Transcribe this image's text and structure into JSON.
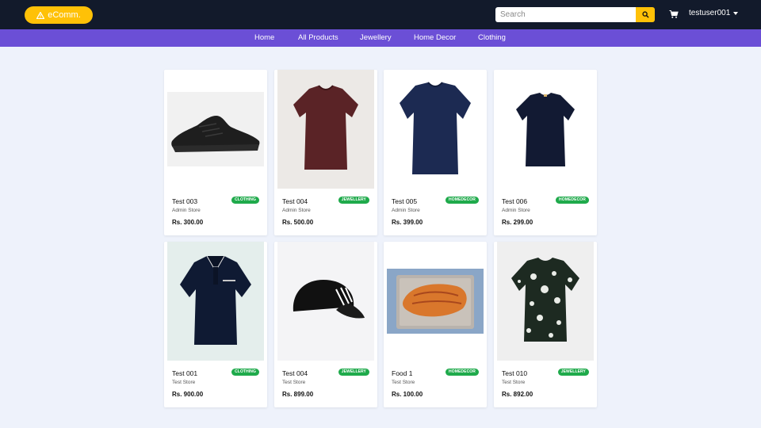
{
  "brand": {
    "name": "eComm.",
    "color": "#ffc107"
  },
  "search": {
    "placeholder": "Search"
  },
  "cart": {
    "icon": "cart-icon"
  },
  "user": {
    "name": "testuser001"
  },
  "nav": [
    {
      "label": "Home"
    },
    {
      "label": "All Products"
    },
    {
      "label": "Jewellery"
    },
    {
      "label": "Home Decor"
    },
    {
      "label": "Clothing"
    }
  ],
  "products": [
    {
      "title": "Test 003",
      "tag": "CLOTHING",
      "store": "Admin Store",
      "price": "Rs. 300.00",
      "image": "black-sneaker"
    },
    {
      "title": "Test 004",
      "tag": "JEWELLERY",
      "store": "Admin Store",
      "price": "Rs. 500.00",
      "image": "maroon-tshirt"
    },
    {
      "title": "Test 005",
      "tag": "HOMEDECOR",
      "store": "Admin Store",
      "price": "Rs. 399.00",
      "image": "navy-tshirt"
    },
    {
      "title": "Test 006",
      "tag": "HOMEDECOR",
      "store": "Admin Store",
      "price": "Rs. 299.00",
      "image": "navy-tshirt-small"
    },
    {
      "title": "Test 001",
      "tag": "CLOTHING",
      "store": "Test Store",
      "price": "Rs. 900.00",
      "image": "navy-polo"
    },
    {
      "title": "Test 004",
      "tag": "JEWELLERY",
      "store": "Test Store",
      "price": "Rs. 899.00",
      "image": "black-cap"
    },
    {
      "title": "Food 1",
      "tag": "HOMEDECOR",
      "store": "Test Store",
      "price": "Rs. 100.00",
      "image": "salmon-tray"
    },
    {
      "title": "Test 010",
      "tag": "JEWELLERY",
      "store": "Test Store",
      "price": "Rs. 892.00",
      "image": "floral-tshirt"
    }
  ],
  "colors": {
    "topbar": "#121a2b",
    "catbar": "#6b4fd6",
    "tag": "#1faa4b",
    "background": "#eef2fb"
  }
}
